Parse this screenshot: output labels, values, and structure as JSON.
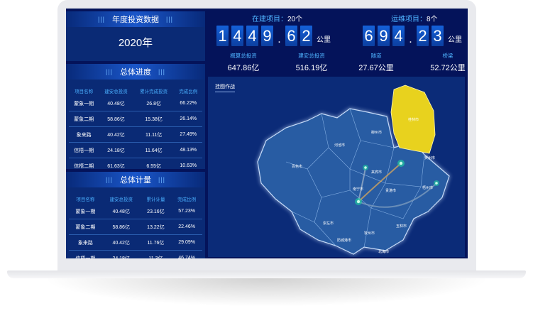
{
  "annual": {
    "title": "年度投资数据",
    "year": "2020年"
  },
  "progress": {
    "title": "总体进度",
    "headers": [
      "项目名称",
      "建安总投资",
      "累计完成投资",
      "完成比例"
    ],
    "rows": [
      [
        "蒙象一期",
        "40.48亿",
        "26.8亿",
        "66.22%"
      ],
      [
        "蒙象二期",
        "58.86亿",
        "15.38亿",
        "26.14%"
      ],
      [
        "象来路",
        "40.42亿",
        "11.11亿",
        "27.49%"
      ],
      [
        "信梧一期",
        "24.18亿",
        "11.64亿",
        "48.13%"
      ],
      [
        "信梧二期",
        "61.63亿",
        "6.55亿",
        "10.63%"
      ]
    ]
  },
  "metering": {
    "title": "总体计量",
    "headers": [
      "项目名称",
      "建安总投资",
      "累计计量",
      "完成比例"
    ],
    "rows": [
      [
        "蒙象一期",
        "40.48亿",
        "23.16亿",
        "57.23%"
      ],
      [
        "蒙象二期",
        "58.86亿",
        "13.22亿",
        "22.46%"
      ],
      [
        "象来路",
        "40.42亿",
        "11.76亿",
        "29.09%"
      ],
      [
        "信梧一期",
        "24.18亿",
        "11.3亿",
        "46.74%"
      ]
    ]
  },
  "construction": {
    "label": "在建项目：",
    "count": "20个",
    "digits": [
      "1",
      "4",
      "4",
      "9",
      ".",
      "6",
      "2"
    ],
    "unit": "公里",
    "stats": [
      {
        "label": "概算总投资",
        "value": "647.86亿"
      },
      {
        "label": "建安总投资",
        "value": "516.19亿"
      }
    ]
  },
  "operation": {
    "label": "运维项目：",
    "count": "8个",
    "digits": [
      "6",
      "9",
      "4",
      ".",
      "2",
      "3"
    ],
    "unit": "公里",
    "stats": [
      {
        "label": "隧道",
        "value": "27.67公里"
      },
      {
        "label": "桥梁",
        "value": "52.72公里"
      }
    ]
  },
  "map": {
    "title": "挂图作战",
    "highlight_color": "#e8d21e",
    "cities": [
      "桂林市",
      "柳州市",
      "河池市",
      "百色市",
      "来宾市",
      "贺州市",
      "梧州市",
      "南宁市",
      "贵港市",
      "崇左市",
      "玉林市",
      "钦州市",
      "防城港市",
      "北海市"
    ]
  }
}
